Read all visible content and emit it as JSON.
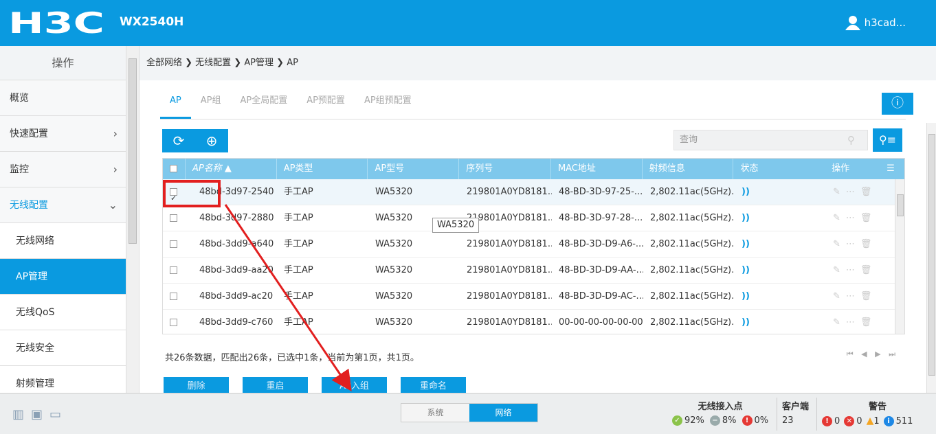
{
  "header": {
    "brand": "H3C",
    "model": "WX2540H",
    "user": "h3cad..."
  },
  "sidebar": {
    "title": "操作",
    "items": [
      {
        "label": "概览"
      },
      {
        "label": "快速配置",
        "chev": ">"
      },
      {
        "label": "监控",
        "chev": ">"
      },
      {
        "label": "无线配置",
        "chev": "⌄"
      }
    ],
    "subitems": [
      {
        "label": "无线网络"
      },
      {
        "label": "AP管理"
      },
      {
        "label": "无线QoS"
      },
      {
        "label": "无线安全"
      },
      {
        "label": "射频管理"
      }
    ]
  },
  "breadcrumb": "全部网络 ❯ 无线配置 ❯ AP管理 ❯ AP",
  "tabs": [
    {
      "label": "AP"
    },
    {
      "label": "AP组"
    },
    {
      "label": "AP全局配置"
    },
    {
      "label": "AP预配置"
    },
    {
      "label": "AP组预配置"
    }
  ],
  "search": {
    "placeholder": "查询"
  },
  "table": {
    "headers": [
      "AP名称 ▲",
      "AP类型",
      "AP型号",
      "序列号",
      "MAC地址",
      "射频信息",
      "状态",
      "操作"
    ],
    "rows": [
      {
        "name": "48bd-3d97-2540",
        "type": "手工AP",
        "model": "WA5320",
        "serial": "219801A0YD8181...",
        "mac": "48-BD-3D-97-25-...",
        "radio": "2,802.11ac(5GHz)...",
        "checked": true
      },
      {
        "name": "48bd-3d97-2880",
        "type": "手工AP",
        "model": "WA5320",
        "serial": "219801A0YD8181...",
        "mac": "48-BD-3D-97-28-...",
        "radio": "2,802.11ac(5GHz)..."
      },
      {
        "name": "48bd-3dd9-a640",
        "type": "手工AP",
        "model": "WA5320",
        "serial": "219801A0YD8181...",
        "mac": "48-BD-3D-D9-A6-...",
        "radio": "2,802.11ac(5GHz)..."
      },
      {
        "name": "48bd-3dd9-aa20",
        "type": "手工AP",
        "model": "WA5320",
        "serial": "219801A0YD8181...",
        "mac": "48-BD-3D-D9-AA-...",
        "radio": "2,802.11ac(5GHz)..."
      },
      {
        "name": "48bd-3dd9-ac20",
        "type": "手工AP",
        "model": "WA5320",
        "serial": "219801A0YD8181...",
        "mac": "48-BD-3D-D9-AC-...",
        "radio": "2,802.11ac(5GHz)..."
      },
      {
        "name": "48bd-3dd9-c760",
        "type": "手工AP",
        "model": "WA5320",
        "serial": "219801A0YD8181...",
        "mac": "00-00-00-00-00-00",
        "radio": "2,802.11ac(5GHz)..."
      }
    ]
  },
  "tooltip": "WA5320",
  "summary": "共26条数据，匹配出26条，已选中1条，当前为第1页，共1页。",
  "buttons": {
    "delete": "删除",
    "restart": "重启",
    "join_group": "AP入组",
    "rename": "重命名"
  },
  "footer": {
    "toggle": {
      "system": "系统",
      "network": "网络"
    },
    "ap_title": "无线接入点",
    "ap_online": "92%",
    "ap_other": "8%",
    "ap_fault": "0%",
    "client_title": "客户端",
    "client_count": "23",
    "alarm_title": "警告",
    "alarm_critical": "0",
    "alarm_major": "0",
    "alarm_warning": "1",
    "alarm_info": "511"
  }
}
